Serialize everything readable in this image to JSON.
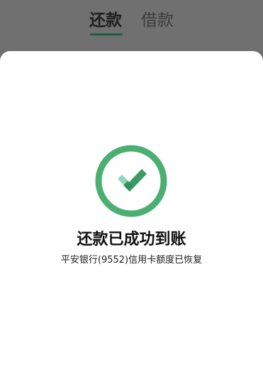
{
  "tabs": {
    "active_label": "还款",
    "inactive_label": "借款"
  },
  "result": {
    "icon": "check-circle-icon",
    "title": "还款已成功到账",
    "subtitle": "平安银行(9552)信用卡额度已恢复"
  },
  "colors": {
    "accent": "#4CAF72",
    "accent_light": "#8FD8B6",
    "accent_dark": "#3B9B63",
    "backdrop": "#6F6F6F"
  }
}
